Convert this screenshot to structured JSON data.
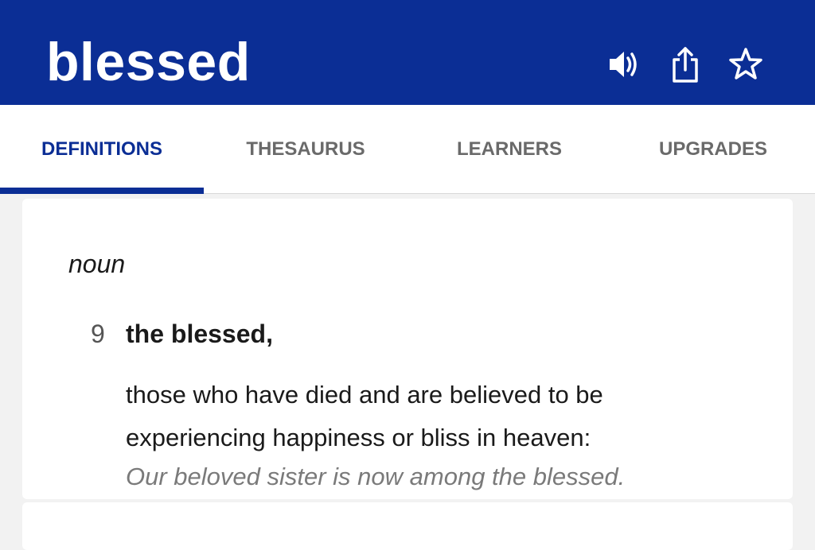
{
  "header": {
    "word": "blessed",
    "background_color": "#0b2e95",
    "icons": [
      "speaker-icon",
      "share-icon",
      "star-icon"
    ]
  },
  "tabs": [
    {
      "label": "DEFINITIONS",
      "active": true
    },
    {
      "label": "THESAURUS",
      "active": false
    },
    {
      "label": "LEARNERS",
      "active": false
    },
    {
      "label": "UPGRADES",
      "active": false
    }
  ],
  "entry": {
    "part_of_speech": "noun",
    "sense_number": "9",
    "sense_headword": "the blessed,",
    "definition_line1": "those who have died and are believed to be",
    "definition_line2": "experiencing happiness or bliss in heaven:",
    "example": "Our beloved sister is now among the blessed."
  },
  "colors": {
    "accent": "#0b2e95",
    "inactive_tab": "#6a6a6a",
    "example_text": "#7a7a7a"
  }
}
